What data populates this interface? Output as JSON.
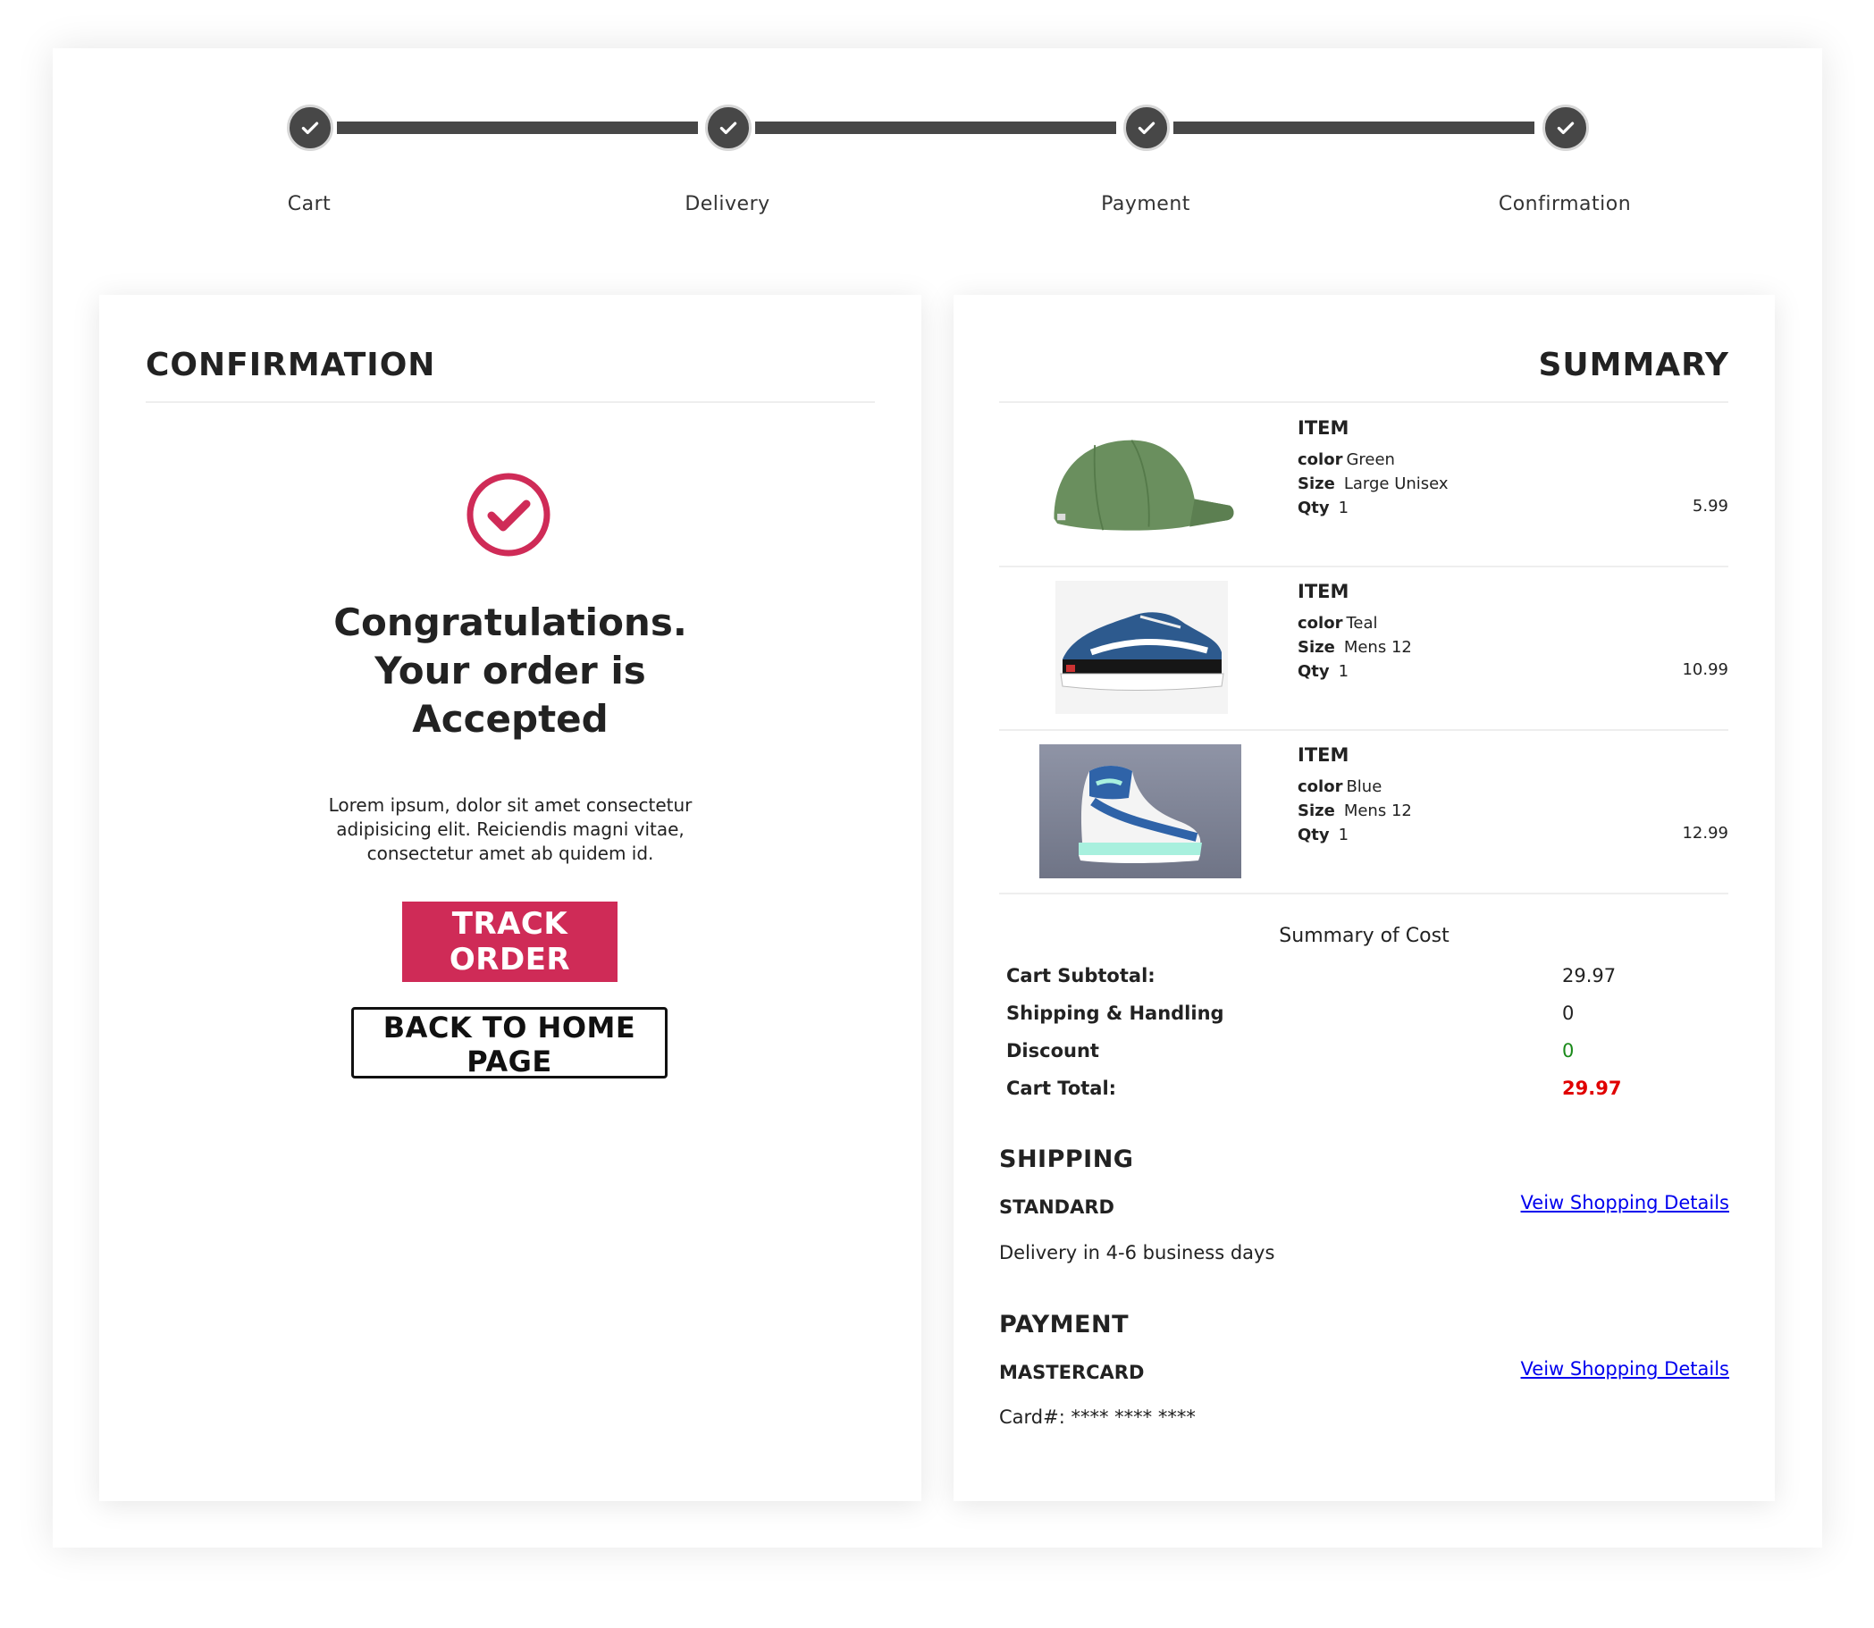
{
  "stepper": {
    "steps": [
      {
        "label": "Cart",
        "done": true
      },
      {
        "label": "Delivery",
        "done": true
      },
      {
        "label": "Payment",
        "done": true
      },
      {
        "label": "Confirmation",
        "done": true
      }
    ]
  },
  "confirmation": {
    "title": "CONFIRMATION",
    "heading_line1": "Congratulations.",
    "heading_line2": "Your order is",
    "heading_line3": "Accepted",
    "body": "Lorem ipsum, dolor sit amet consectetur adipisicing elit. Reiciendis magni vitae, consectetur amet ab quidem id.",
    "track_button": "TRACK ORDER",
    "home_button": "BACK TO HOME PAGE",
    "accent_color": "#cf2b57"
  },
  "summary": {
    "title": "SUMMARY",
    "items": [
      {
        "title": "ITEM",
        "color_label": "color",
        "color": "Green",
        "size_label": "Size",
        "size": "Large Unisex",
        "qty_label": "Qty",
        "qty": "1",
        "price": "5.99",
        "image": "green-cap"
      },
      {
        "title": "ITEM",
        "color_label": "color",
        "color": "Teal",
        "size_label": "Size",
        "size": "Mens 12",
        "qty_label": "Qty",
        "qty": "1",
        "price": "10.99",
        "image": "blue-skate-shoe"
      },
      {
        "title": "ITEM",
        "color_label": "color",
        "color": "Blue",
        "size_label": "Size",
        "size": "Mens 12",
        "qty_label": "Qty",
        "qty": "1",
        "price": "12.99",
        "image": "high-top-sneaker"
      }
    ],
    "cost_title": "Summary of Cost",
    "cost": {
      "subtotal_label": "Cart Subtotal:",
      "subtotal": "29.97",
      "shipping_label": "Shipping & Handling",
      "shipping": "0",
      "discount_label": "Discount",
      "discount": "0",
      "total_label": "Cart Total:",
      "total": "29.97"
    },
    "shipping": {
      "title": "SHIPPING",
      "method": "STANDARD",
      "details": "Delivery in 4-6 business days",
      "link": "Veiw Shopping Details"
    },
    "payment": {
      "title": "PAYMENT",
      "method": "MASTERCARD",
      "card": "Card#: **** **** ****",
      "link": "Veiw Shopping Details"
    },
    "colors": {
      "discount": "#1a8a1a",
      "total": "#e00000",
      "link": "#0000ee"
    }
  }
}
